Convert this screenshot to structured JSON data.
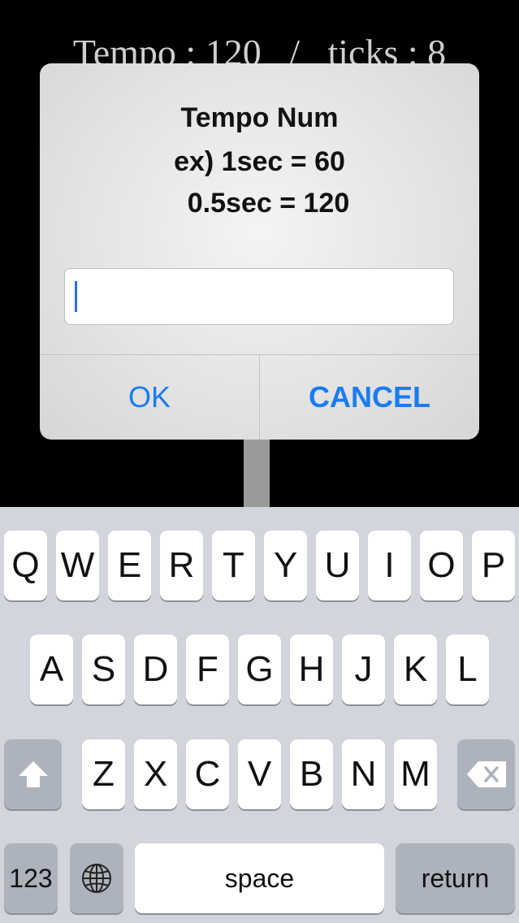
{
  "background": {
    "header": "Tempo : 120   /   ticks : 8"
  },
  "alert": {
    "title": "Tempo Num",
    "message_line1": "ex) 1sec = 60",
    "message_line2": "0.5sec = 120",
    "input_value": "",
    "ok_label": "OK",
    "cancel_label": "CANCEL"
  },
  "keyboard": {
    "row1": [
      "Q",
      "W",
      "E",
      "R",
      "T",
      "Y",
      "U",
      "I",
      "O",
      "P"
    ],
    "row2": [
      "A",
      "S",
      "D",
      "F",
      "G",
      "H",
      "J",
      "K",
      "L"
    ],
    "row3": [
      "Z",
      "X",
      "C",
      "V",
      "B",
      "N",
      "M"
    ],
    "numbers_label": "123",
    "space_label": "space",
    "return_label": "return",
    "shift_icon": "shift-arrow-icon",
    "delete_icon": "delete-backspace-icon",
    "globe_icon": "globe-icon"
  },
  "colors": {
    "accent": "#1a7cf0",
    "caret": "#2a6fe8"
  }
}
